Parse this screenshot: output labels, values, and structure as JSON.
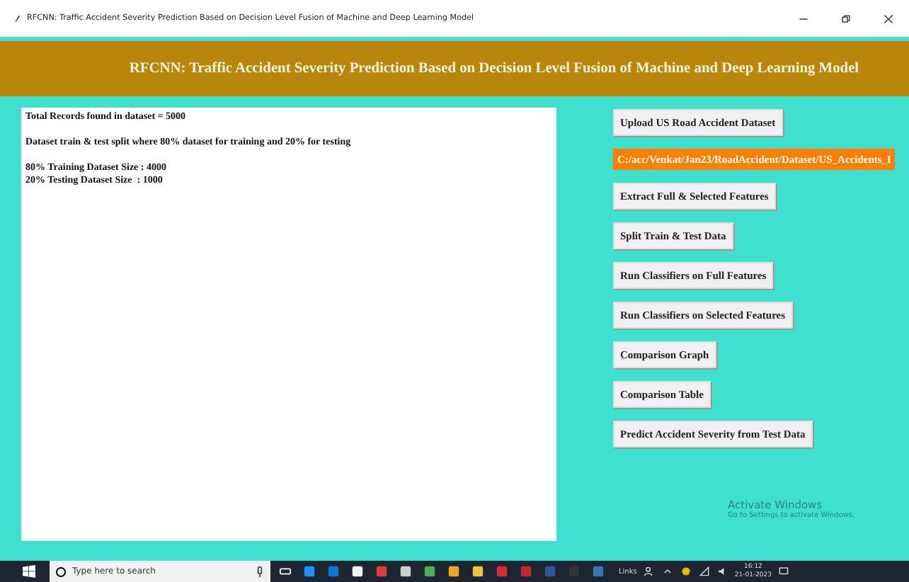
{
  "window": {
    "title": "RFCNN: Traffic Accident Severity Prediction Based on Decision Level Fusion of Machine and Deep Learning Model"
  },
  "header": {
    "title": "RFCNN: Traffic Accident Severity Prediction Based on Decision Level Fusion of Machine and Deep Learning Model"
  },
  "output": {
    "paragraphs": [
      [
        "Total Records found in dataset = 5000"
      ],
      [
        "Dataset train & test split where 80% dataset for training and 20% for testing"
      ],
      [
        "80% Training Dataset Size : 4000",
        "20% Testing Dataset Size  : 1000"
      ]
    ]
  },
  "actions": [
    {
      "kind": "button",
      "label": "Upload US Road Accident Dataset"
    },
    {
      "kind": "path",
      "label": "C:/acc/Venkat/Jan23/RoadAccident/Dataset/US_Accidents_I"
    },
    {
      "kind": "button",
      "label": "Extract Full & Selected Features"
    },
    {
      "kind": "button",
      "label": "Split Train & Test Data"
    },
    {
      "kind": "button",
      "label": "Run Classifiers on Full Features"
    },
    {
      "kind": "button",
      "label": "Run Classifiers on Selected Features"
    },
    {
      "kind": "button",
      "label": "Comparison Graph"
    },
    {
      "kind": "button",
      "label": "Comparison Table"
    },
    {
      "kind": "button",
      "label": "Predict Accident Severity from Test Data"
    }
  ],
  "activation_notice": {
    "title": "Activate Windows",
    "subtitle": "Go to Settings to activate Windows."
  },
  "taskbar": {
    "search": {
      "placeholder": "Type here to search"
    },
    "links": "Links",
    "time": "16:12",
    "date": "21-01-2023"
  }
}
